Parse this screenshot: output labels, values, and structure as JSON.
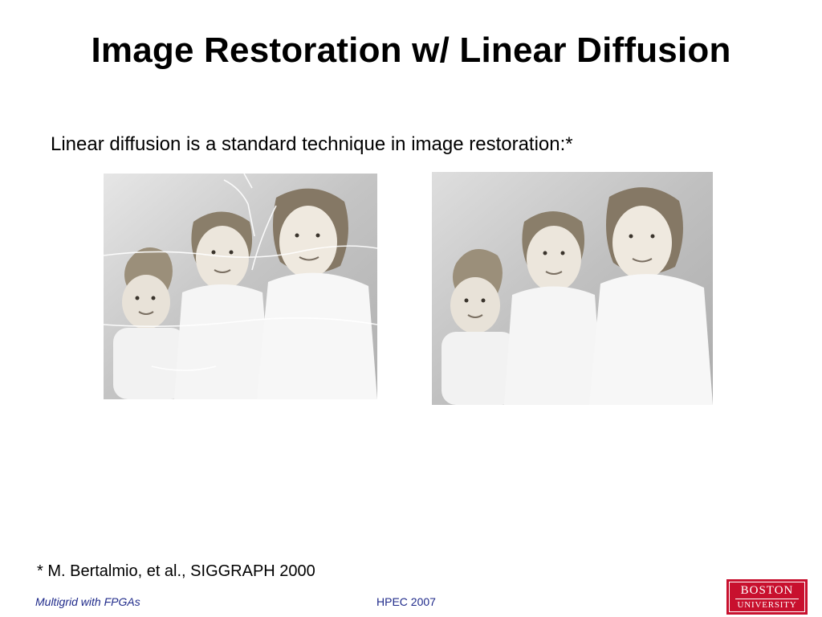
{
  "slide": {
    "title": "Image Restoration w/ Linear Diffusion",
    "subtitle": "Linear diffusion is a standard technique in image restoration:*",
    "footnote": "* M. Bertalmio, et al., SIGGRAPH 2000"
  },
  "images": {
    "left": {
      "caption": "",
      "kind": "damaged-photo"
    },
    "right": {
      "caption": "",
      "kind": "restored-photo"
    }
  },
  "footer": {
    "left_text": "Multigrid with FPGAs",
    "center_text": "HPEC 2007",
    "color": "#1f2a8a"
  },
  "logo": {
    "line1": "BOSTON",
    "line2": "UNIVERSITY",
    "color": "#c8102e"
  }
}
